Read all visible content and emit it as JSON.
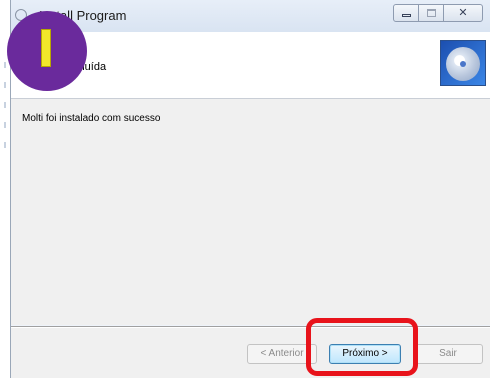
{
  "window": {
    "title": "Install Program",
    "controls": {
      "minimize_icon": "minimize-icon",
      "maximize_icon": "maximize-icon",
      "close_glyph": "✕"
    }
  },
  "header": {
    "title": "concluída",
    "icon": "cd-icon"
  },
  "content": {
    "message": "Molti foi instalado com sucesso"
  },
  "buttons": {
    "back": "< Anterior",
    "next": "Próximo >",
    "exit": "Sair"
  },
  "annotation": {
    "badge_letter": "I",
    "highlight_color": "#e8131b",
    "badge_color": "#6a2a9c",
    "badge_bar_color": "#f2e82a"
  }
}
